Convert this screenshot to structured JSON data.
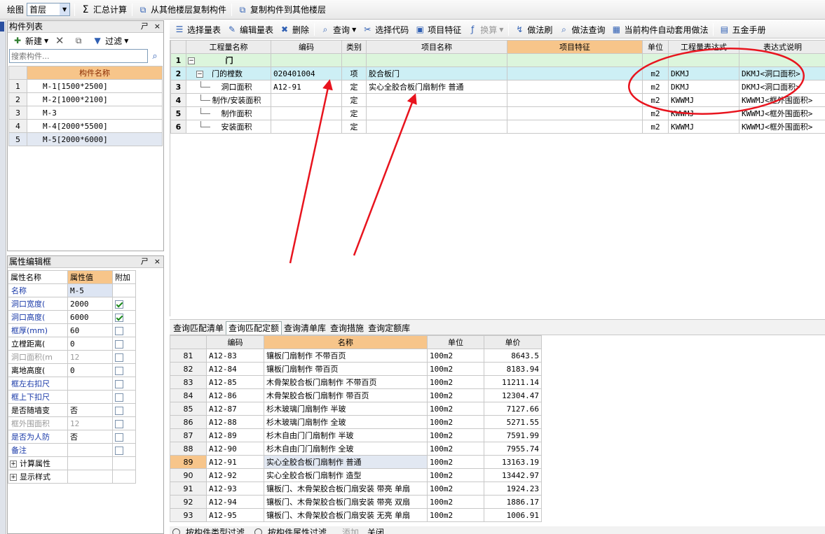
{
  "top_toolbar": {
    "draw_label": "绘图",
    "floor_value": "首层",
    "sum_label": "汇总计算",
    "copy_from_label": "从其他楼层复制构件",
    "copy_to_label": "复制构件到其他楼层"
  },
  "component_list": {
    "title": "构件列表",
    "title_controls": [
      "ㄕ",
      "×"
    ],
    "new_label": "新建",
    "filter_label": "过滤",
    "search_placeholder": "搜索构件...",
    "column_header": "构件名称",
    "items": [
      {
        "n": "1",
        "name": "M-1[1500*2500]"
      },
      {
        "n": "2",
        "name": "M-2[1000*2100]"
      },
      {
        "n": "3",
        "name": "M-3"
      },
      {
        "n": "4",
        "name": "M-4[2000*5500]"
      },
      {
        "n": "5",
        "name": "M-5[2000*6000]"
      }
    ]
  },
  "property_editor": {
    "title": "属性编辑框",
    "title_controls": [
      "ㄕ",
      "×"
    ],
    "headers": [
      "属性名称",
      "属性值",
      "附加"
    ],
    "rows": [
      {
        "name": "名称",
        "value": "M-5",
        "checkbox": null,
        "style": "blue"
      },
      {
        "name": "洞口宽度(",
        "value": "2000",
        "checkbox": true,
        "style": "blue"
      },
      {
        "name": "洞口高度(",
        "value": "6000",
        "checkbox": true,
        "style": "blue"
      },
      {
        "name": "框厚(mm)",
        "value": "60",
        "checkbox": false,
        "style": "blue"
      },
      {
        "name": "立樘距离(",
        "value": "0",
        "checkbox": false,
        "style": "normal"
      },
      {
        "name": "洞口面积(m",
        "value": "12",
        "checkbox": false,
        "style": "gray"
      },
      {
        "name": "离地高度(",
        "value": "0",
        "checkbox": false,
        "style": "normal"
      },
      {
        "name": "框左右扣尺",
        "value": "",
        "checkbox": false,
        "style": "blue"
      },
      {
        "name": "框上下扣尺",
        "value": "",
        "checkbox": false,
        "style": "blue"
      },
      {
        "name": "是否随墙变",
        "value": "否",
        "checkbox": false,
        "style": "normal"
      },
      {
        "name": "框外围面积",
        "value": "12",
        "checkbox": false,
        "style": "gray"
      },
      {
        "name": "是否为人防",
        "value": "否",
        "checkbox": false,
        "style": "blue"
      },
      {
        "name": "备注",
        "value": "",
        "checkbox": false,
        "style": "blue"
      }
    ],
    "groups": [
      {
        "label": "计算属性"
      },
      {
        "label": "显示样式"
      }
    ]
  },
  "main_toolbar": {
    "items": [
      {
        "label": "选择量表",
        "icon": "select-list-icon",
        "glyph": "☰"
      },
      {
        "label": "编辑量表",
        "icon": "edit-list-icon",
        "glyph": "✎"
      },
      {
        "label": "删除",
        "icon": "delete-icon",
        "glyph": "✖"
      },
      {
        "label": "查询",
        "icon": "query-icon",
        "glyph": "⌕",
        "caret": true
      },
      {
        "label": "选择代码",
        "icon": "select-code-icon",
        "glyph": "✂"
      },
      {
        "label": "项目特征",
        "icon": "project-feature-icon",
        "glyph": "▣"
      },
      {
        "label": "换算",
        "icon": "convert-icon",
        "glyph": "ƒ",
        "caret": true,
        "disabled": true
      },
      {
        "label": "做法刷",
        "icon": "method-brush-icon",
        "glyph": "↯"
      },
      {
        "label": "做法查询",
        "icon": "method-query-icon",
        "glyph": "⌕"
      },
      {
        "label": "当前构件自动套用做法",
        "icon": "auto-apply-icon",
        "glyph": "▦"
      },
      {
        "label": "五金手册",
        "icon": "hardware-manual-icon",
        "glyph": "▤"
      }
    ]
  },
  "quantity_table": {
    "headers": [
      "工程量名称",
      "编码",
      "类别",
      "项目名称",
      "项目特征",
      "单位",
      "工程量表达式",
      "表达式说明"
    ],
    "rows": [
      {
        "n": "1",
        "name": "门",
        "code": "",
        "cat": "",
        "item": "",
        "feature": "",
        "unit": "",
        "expr": "",
        "desc": "",
        "kind": "group"
      },
      {
        "n": "2",
        "name": "门的樘数",
        "code": "020401004",
        "cat": "项",
        "item": "胶合板门",
        "feature": "",
        "unit": "m2",
        "expr": "DKMJ",
        "desc": "DKMJ<洞口面积>",
        "kind": "item"
      },
      {
        "n": "3",
        "name": "洞口面积",
        "code": "A12-91",
        "cat": "定",
        "item": "实心全胶合板门扇制作 普通",
        "feature": "",
        "unit": "m2",
        "expr": "DKMJ",
        "desc": "DKMJ<洞口面积>",
        "kind": "sub"
      },
      {
        "n": "4",
        "name": "制作/安装面积",
        "code": "",
        "cat": "定",
        "item": "",
        "feature": "",
        "unit": "m2",
        "expr": "KWWMJ",
        "desc": "KWWMJ<框外围面积>",
        "kind": "sub"
      },
      {
        "n": "5",
        "name": "制作面积",
        "code": "",
        "cat": "定",
        "item": "",
        "feature": "",
        "unit": "m2",
        "expr": "KWWMJ",
        "desc": "KWWMJ<框外围面积>",
        "kind": "sub"
      },
      {
        "n": "6",
        "name": "安装面积",
        "code": "",
        "cat": "定",
        "item": "",
        "feature": "",
        "unit": "m2",
        "expr": "KWWMJ",
        "desc": "KWWMJ<框外围面积>",
        "kind": "sub"
      }
    ]
  },
  "query_tabs": [
    "查询匹配清单",
    "查询匹配定额",
    "查询清单库",
    "查询措施",
    "查询定额库"
  ],
  "active_query_tab": 1,
  "norm_table": {
    "headers": [
      "编码",
      "名称",
      "单位",
      "单价"
    ],
    "rows": [
      {
        "n": "81",
        "code": "A12-83",
        "name": "镶板门扇制作 不带百页",
        "unit": "100m2",
        "price": "8643.5"
      },
      {
        "n": "82",
        "code": "A12-84",
        "name": "镶板门扇制作 带百页",
        "unit": "100m2",
        "price": "8183.94"
      },
      {
        "n": "83",
        "code": "A12-85",
        "name": "木骨架胶合板门扇制作 不带百页",
        "unit": "100m2",
        "price": "11211.14"
      },
      {
        "n": "84",
        "code": "A12-86",
        "name": "木骨架胶合板门扇制作 带百页",
        "unit": "100m2",
        "price": "12304.47"
      },
      {
        "n": "85",
        "code": "A12-87",
        "name": "杉木玻璃门扇制作 半玻",
        "unit": "100m2",
        "price": "7127.66"
      },
      {
        "n": "86",
        "code": "A12-88",
        "name": "杉木玻璃门扇制作 全玻",
        "unit": "100m2",
        "price": "5271.55"
      },
      {
        "n": "87",
        "code": "A12-89",
        "name": "杉木自由门门扇制作 半玻",
        "unit": "100m2",
        "price": "7591.99"
      },
      {
        "n": "88",
        "code": "A12-90",
        "name": "杉木自由门门扇制作 全玻",
        "unit": "100m2",
        "price": "7955.74"
      },
      {
        "n": "89",
        "code": "A12-91",
        "name": "实心全胶合板门扇制作 普通",
        "unit": "100m2",
        "price": "13163.19",
        "selected": true
      },
      {
        "n": "90",
        "code": "A12-92",
        "name": "实心全胶合板门扇制作 造型",
        "unit": "100m2",
        "price": "13442.97"
      },
      {
        "n": "91",
        "code": "A12-93",
        "name": "镶板门、木骨架胶合板门扇安装 带亮 单扇",
        "unit": "100m2",
        "price": "1924.23"
      },
      {
        "n": "92",
        "code": "A12-94",
        "name": "镶板门、木骨架胶合板门扇安装 带亮 双扇",
        "unit": "100m2",
        "price": "1886.17"
      },
      {
        "n": "93",
        "code": "A12-95",
        "name": "镶板门、木骨架胶合板门扇安装 无亮 单扇",
        "unit": "100m2",
        "price": "1006.91"
      }
    ]
  },
  "bottom_bar": {
    "radio1": "按构件类型过滤",
    "radio2": "按构件属性过滤",
    "add_label": "添加",
    "close_label": "关闭"
  },
  "colors": {
    "accent_orange": "#f7c58a",
    "annotation_red": "#e8141e",
    "group_row": "#dcf5dc",
    "selected_row": "#cdeff5"
  }
}
